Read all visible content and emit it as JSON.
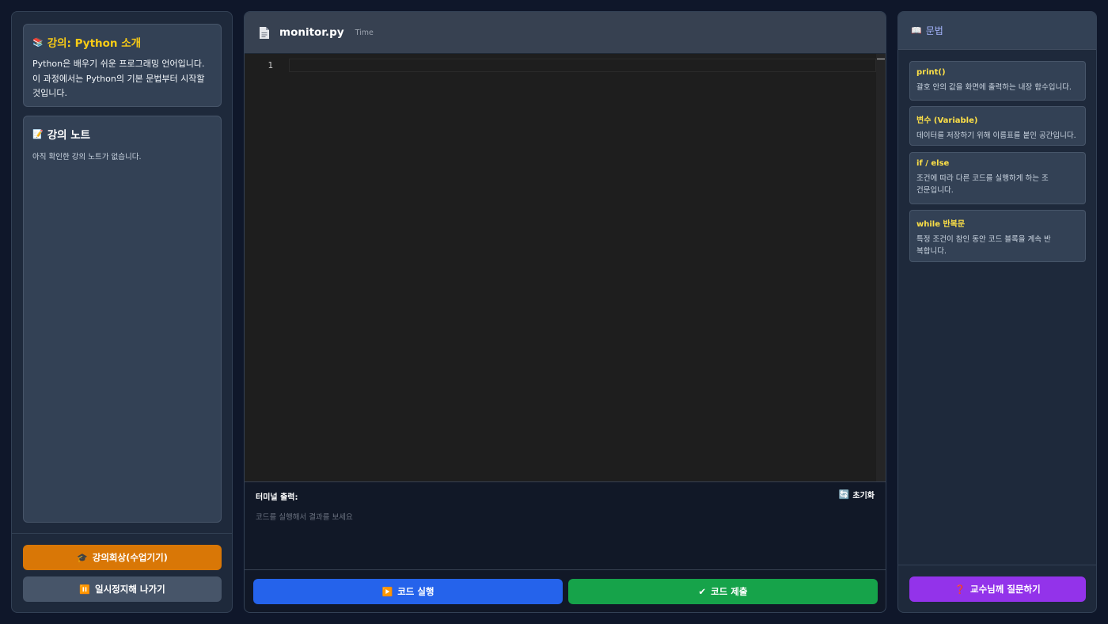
{
  "left": {
    "lecture": {
      "icon": "books-icon",
      "title": "강의: Python 소개",
      "body": "Python은 배우기 쉬운 프로그래밍 언어입니다. 이 과정에서는 Python의 기본 문법부터 시작할 것입니다."
    },
    "notes": {
      "icon": "memo-icon",
      "title": "강의 노트",
      "empty": "아직 확인한 강의 노트가 없습니다."
    },
    "review_label": "강의회상(수업기기)",
    "pause_label": "일시정지해 나가기"
  },
  "editor": {
    "file_name": "monitor.py",
    "file_sub": "Time",
    "line_number": "1"
  },
  "terminal": {
    "label": "터미널 출력:",
    "reset_label": "초기화",
    "placeholder": "코드를 실행해서 결과를 보세요"
  },
  "actions": {
    "run_label": "코드 실행",
    "submit_label": "코드 제출"
  },
  "grammar": {
    "title": "문법",
    "items": [
      {
        "term": "print()",
        "desc": "괄호 안의 값을 화면에 출력하는 내장 함수입니다."
      },
      {
        "term": "변수 (Variable)",
        "desc": "데이터를 저장하기 위해 이름표를 붙인 공간입니다."
      },
      {
        "term": "if / else",
        "desc": "조건에 따라 다른 코드를 실행하게 하는 조건문입니다."
      },
      {
        "term": "while 반복문",
        "desc": "특정 조건이 참인 동안 코드 블록을 계속 반복합니다."
      }
    ],
    "ask_label": "교수님께 질문하기"
  },
  "colors": {
    "background": "#0f172a",
    "panel": "#1e293b",
    "accent_yellow": "#facc15",
    "review": "#d97706",
    "run": "#2563eb",
    "submit": "#16a34a",
    "ask": "#9333ea"
  }
}
